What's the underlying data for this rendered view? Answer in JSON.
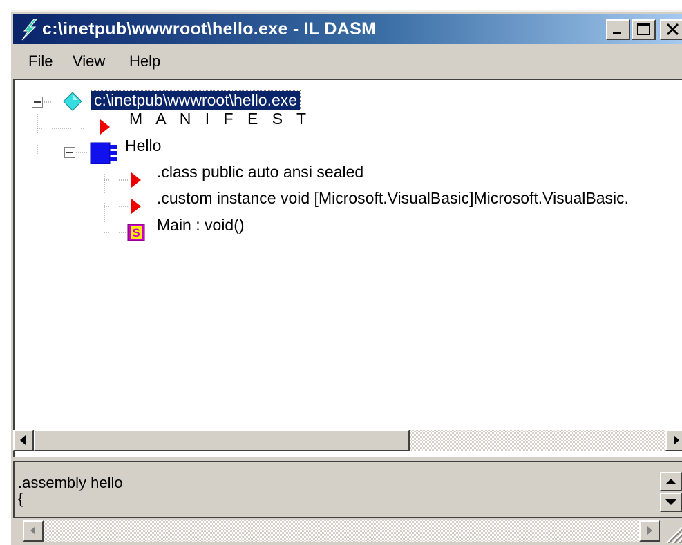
{
  "window": {
    "title": "c:\\inetpub\\wwwroot\\hello.exe - IL DASM",
    "colors": {
      "titlebar_start": "#0a246a",
      "titlebar_end": "#a6caf0",
      "face": "#d4d0c8",
      "selection": "#0a246a"
    }
  },
  "menu": [
    {
      "label": "File"
    },
    {
      "label": "View"
    },
    {
      "label": "Help"
    }
  ],
  "tree": {
    "root": {
      "label": "c:\\inetpub\\wwwroot\\hello.exe",
      "icon": "assembly-diamond-icon",
      "selected": true
    },
    "manifest": {
      "label": "M A N I F E S T",
      "icon": "red-triangle-icon"
    },
    "class": {
      "label": "Hello",
      "icon": "class-icon"
    },
    "children": [
      {
        "label": ".class public auto ansi sealed",
        "icon": "red-triangle-icon"
      },
      {
        "label": ".custom instance void [Microsoft.VisualBasic]Microsoft.VisualBasic.",
        "icon": "red-triangle-icon"
      },
      {
        "label": "Main : void()",
        "icon": "static-method-icon",
        "icon_letter": "S"
      }
    ]
  },
  "detail": {
    "line1": ".assembly hello",
    "line2": "{"
  }
}
